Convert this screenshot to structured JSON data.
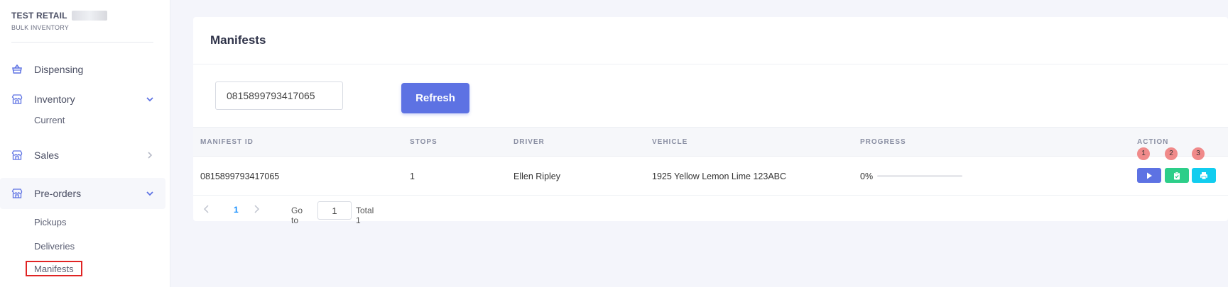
{
  "brand": {
    "title": "TEST RETAIL",
    "subtitle": "BULK INVENTORY"
  },
  "sidebar": {
    "items": [
      {
        "label": "Dispensing",
        "icon": "basket-icon"
      },
      {
        "label": "Inventory",
        "icon": "store-icon",
        "expanded": true,
        "children": [
          "Current"
        ]
      },
      {
        "label": "Sales",
        "icon": "store-icon",
        "expanded": false
      },
      {
        "label": "Pre-orders",
        "icon": "store-icon",
        "expanded": true,
        "children": [
          "Pickups",
          "Deliveries",
          "Manifests"
        ],
        "selected_child": "Manifests"
      }
    ]
  },
  "main": {
    "title": "Manifests",
    "search": {
      "value": "0815899793417065",
      "placeholder": ""
    },
    "refresh_label": "Refresh",
    "table": {
      "columns": [
        "MANIFEST ID",
        "STOPS",
        "DRIVER",
        "VEHICLE",
        "PROGRESS",
        "ACTION"
      ],
      "rows": [
        {
          "manifest_id": "0815899793417065",
          "stops": "1",
          "driver": "Ellen Ripley",
          "vehicle": "1925 Yellow Lemon Lime 123ABC",
          "progress_text": "0%",
          "progress": 0
        }
      ],
      "actions": [
        {
          "badge": "1",
          "icon": "play-icon",
          "color": "#5d72e3"
        },
        {
          "badge": "2",
          "icon": "clipboard-check-icon",
          "color": "#2dce89"
        },
        {
          "badge": "3",
          "icon": "printer-icon",
          "color": "#11cdef"
        }
      ]
    },
    "pagination": {
      "current": "1",
      "goto_label": "Go to",
      "goto_value": "1",
      "total_label": "Total 1"
    }
  },
  "colors": {
    "accent": "#5d72e3",
    "highlight": "#e02424",
    "link": "#1890ff"
  }
}
